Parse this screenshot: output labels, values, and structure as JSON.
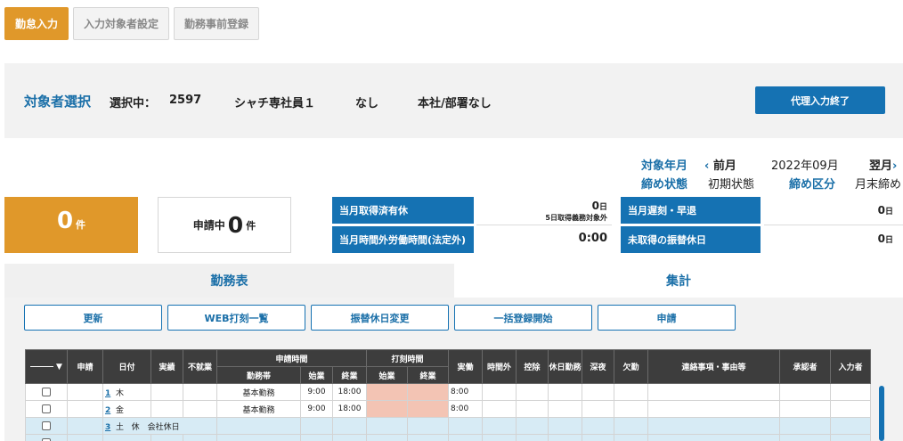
{
  "top_tabs": [
    {
      "label": "勤怠入力",
      "active": true
    },
    {
      "label": "入力対象者設定",
      "active": false
    },
    {
      "label": "勤務事前登録",
      "active": false
    }
  ],
  "target": {
    "title": "対象者選択",
    "selected_label": "選択中：",
    "employee_id": "2597",
    "employee_name": "シャチ専社員１",
    "note": "なし",
    "department": "本社/部署なし",
    "proxy_end_label": "代理入力終了"
  },
  "period": {
    "month_label": "対象年月",
    "prev_label": "前月",
    "month_value": "2022年09月",
    "next_label": "翌月",
    "status_label": "締め状態",
    "status_value": "初期状態",
    "closing_label": "締め区分",
    "closing_value": "月末締め"
  },
  "counts": {
    "alert_count": "0",
    "alert_unit": "件",
    "pending_label": "申請中",
    "pending_count": "0",
    "pending_unit": "件"
  },
  "stats": {
    "paid_leave_label": "当月取得済有休",
    "paid_leave_value": "0",
    "paid_leave_unit": "日",
    "paid_leave_note": "5日取得義務対象外",
    "overtime_label": "当月時間外労働時間(法定外)",
    "overtime_value": "0:00",
    "late_label": "当月遅刻・早退",
    "late_value": "0",
    "late_unit": "日",
    "substitute_label": "未取得の振替休日",
    "substitute_value": "0",
    "substitute_unit": "日"
  },
  "view_tabs": [
    {
      "label": "勤務表",
      "selected": false
    },
    {
      "label": "集計",
      "selected": true
    }
  ],
  "actions": [
    "更新",
    "WEB打刻一覧",
    "振替休日変更",
    "一括登録開始",
    "申請"
  ],
  "table": {
    "headers": {
      "sort": "▼",
      "apply": "申請",
      "date": "日付",
      "actual": "実績",
      "no_work": "不就業",
      "apply_time": "申請時間",
      "shift": "勤務帯",
      "start": "始業",
      "end": "終業",
      "punch_time": "打刻時間",
      "punch_start": "始業",
      "punch_end": "終業",
      "work": "実働",
      "overtime": "時間外",
      "deduction": "控除",
      "holiday_work": "休日勤務",
      "night": "深夜",
      "absence": "欠勤",
      "remarks": "連絡事項・事由等",
      "approver": "承認者",
      "inputter": "入力者"
    },
    "rows": [
      {
        "day": "1",
        "weekday": "木",
        "kind": "",
        "shift": "基本勤務",
        "start": "9:00",
        "end": "18:00",
        "work": "8:00"
      },
      {
        "day": "2",
        "weekday": "金",
        "kind": "",
        "shift": "基本勤務",
        "start": "9:00",
        "end": "18:00",
        "work": "8:00"
      },
      {
        "day": "3",
        "weekday": "土",
        "kind": "休　会社休日",
        "shift": "",
        "start": "",
        "end": "",
        "work": ""
      }
    ]
  },
  "colors": {
    "accent_orange": "#e0982a",
    "brand_blue": "#1572b3",
    "punch_highlight": "#f3c4b4",
    "holiday_row": "#d7ebf5"
  }
}
